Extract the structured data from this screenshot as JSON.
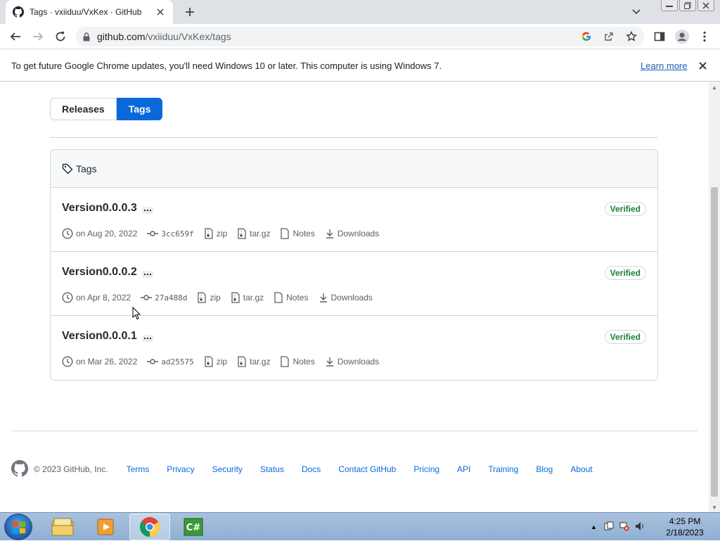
{
  "browser": {
    "tab_title": "Tags · vxiiduu/VxKex · GitHub",
    "url_host": "github.com",
    "url_path": "/vxiiduu/VxKex/tags"
  },
  "infobar": {
    "message": "To get future Google Chrome updates, you'll need Windows 10 or later. This computer is using Windows 7.",
    "link": "Learn more"
  },
  "segmented": {
    "releases": "Releases",
    "tags": "Tags"
  },
  "tags_box": {
    "header": "Tags",
    "items": [
      {
        "name": "Version0.0.0.3",
        "date": "on Aug 20, 2022",
        "commit": "3cc659f",
        "zip": "zip",
        "targz": "tar.gz",
        "notes": "Notes",
        "downloads": "Downloads",
        "badge": "Verified"
      },
      {
        "name": "Version0.0.0.2",
        "date": "on Apr 8, 2022",
        "commit": "27a488d",
        "zip": "zip",
        "targz": "tar.gz",
        "notes": "Notes",
        "downloads": "Downloads",
        "badge": "Verified"
      },
      {
        "name": "Version0.0.0.1",
        "date": "on Mar 26, 2022",
        "commit": "ad25575",
        "zip": "zip",
        "targz": "tar.gz",
        "notes": "Notes",
        "downloads": "Downloads",
        "badge": "Verified"
      }
    ]
  },
  "footer": {
    "copyright": "© 2023 GitHub, Inc.",
    "links": [
      "Terms",
      "Privacy",
      "Security",
      "Status",
      "Docs",
      "Contact GitHub",
      "Pricing",
      "API",
      "Training",
      "Blog",
      "About"
    ]
  },
  "taskbar": {
    "time": "4:25 PM",
    "date": "2/18/2023"
  },
  "colors": {
    "accent": "#0969da",
    "verified": "#1a7f37"
  }
}
